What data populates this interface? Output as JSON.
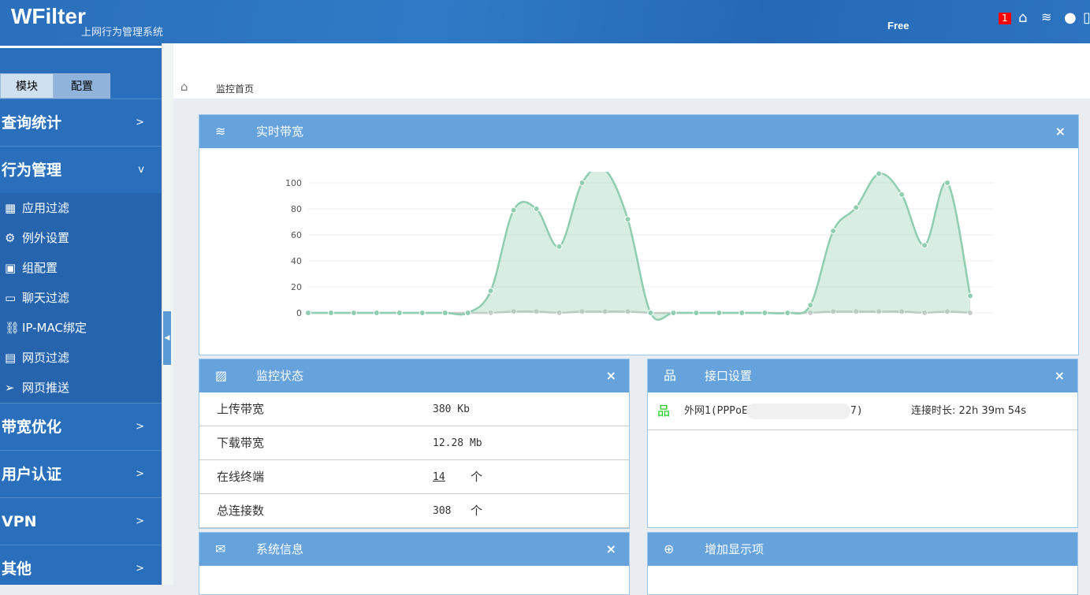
{
  "header": {
    "logo": "WFilter",
    "subtitle": "上网行为管理系统",
    "edition": "Free",
    "notification_count": "1"
  },
  "sidebar": {
    "tabs": [
      "模块",
      "配置"
    ],
    "menu": [
      {
        "label": "查询统计",
        "chevron": ">"
      },
      {
        "label": "行为管理",
        "chevron": "v",
        "expanded": true
      }
    ],
    "submenu": [
      {
        "icon": "grid-icon",
        "glyph": "▦",
        "label": "应用过滤"
      },
      {
        "icon": "gear-icon",
        "glyph": "⚙",
        "label": "例外设置"
      },
      {
        "icon": "id-card-icon",
        "glyph": "▣",
        "label": "组配置"
      },
      {
        "icon": "chat-icon",
        "glyph": "▭",
        "label": "聊天过滤"
      },
      {
        "icon": "link-icon",
        "glyph": "⛓",
        "label": "IP-MAC绑定"
      },
      {
        "icon": "page-icon",
        "glyph": "▤",
        "label": "网页过滤"
      },
      {
        "icon": "send-icon",
        "glyph": "➢",
        "label": "网页推送"
      }
    ],
    "menu2": [
      {
        "label": "带宽优化",
        "chevron": ">"
      },
      {
        "label": "用户认证",
        "chevron": ">"
      },
      {
        "label": "VPN",
        "chevron": ">"
      },
      {
        "label": "其他",
        "chevron": ">"
      }
    ]
  },
  "breadcrumb": {
    "label": "监控首页"
  },
  "bandwidth": {
    "title": "实时带宽",
    "close": "×"
  },
  "status": {
    "title": "监控状态",
    "close": "×",
    "rows": [
      {
        "k": "上传带宽",
        "v": "380 Kb",
        "u": ""
      },
      {
        "k": "下载带宽",
        "v": "12.28 Mb",
        "u": ""
      },
      {
        "k": "在线终端",
        "v": "14",
        "u": "个"
      },
      {
        "k": "总连接数",
        "v": "308",
        "u": "个"
      }
    ]
  },
  "interface": {
    "title": "接口设置",
    "close": "×",
    "name": "外网1(PPPoE",
    "name_end": "7)",
    "uptime": "连接时长: 22h 39m 54s"
  },
  "sysinfo": {
    "title": "系统信息",
    "close": "×"
  },
  "addpanel": {
    "title": "增加显示项"
  },
  "chart_data": {
    "type": "area",
    "ylim": [
      0,
      100
    ],
    "yticks": [
      0,
      20,
      40,
      60,
      80,
      100
    ],
    "grid": true,
    "colors": [
      "#8fceb0",
      "#cccccc"
    ],
    "series": [
      {
        "values": [
          0,
          0,
          0,
          0,
          0,
          0,
          0,
          0,
          17,
          79,
          80,
          51,
          100,
          110,
          72,
          0,
          0,
          0,
          0,
          0,
          0,
          0,
          6,
          63,
          81,
          107,
          91,
          52,
          100,
          13
        ]
      },
      {
        "values": [
          0,
          0,
          0,
          0,
          0,
          0,
          0,
          0,
          0,
          1,
          1,
          0,
          1,
          1,
          1,
          0,
          0,
          0,
          0,
          0,
          0,
          0,
          0,
          1,
          1,
          1,
          1,
          0,
          1,
          0
        ]
      }
    ]
  }
}
